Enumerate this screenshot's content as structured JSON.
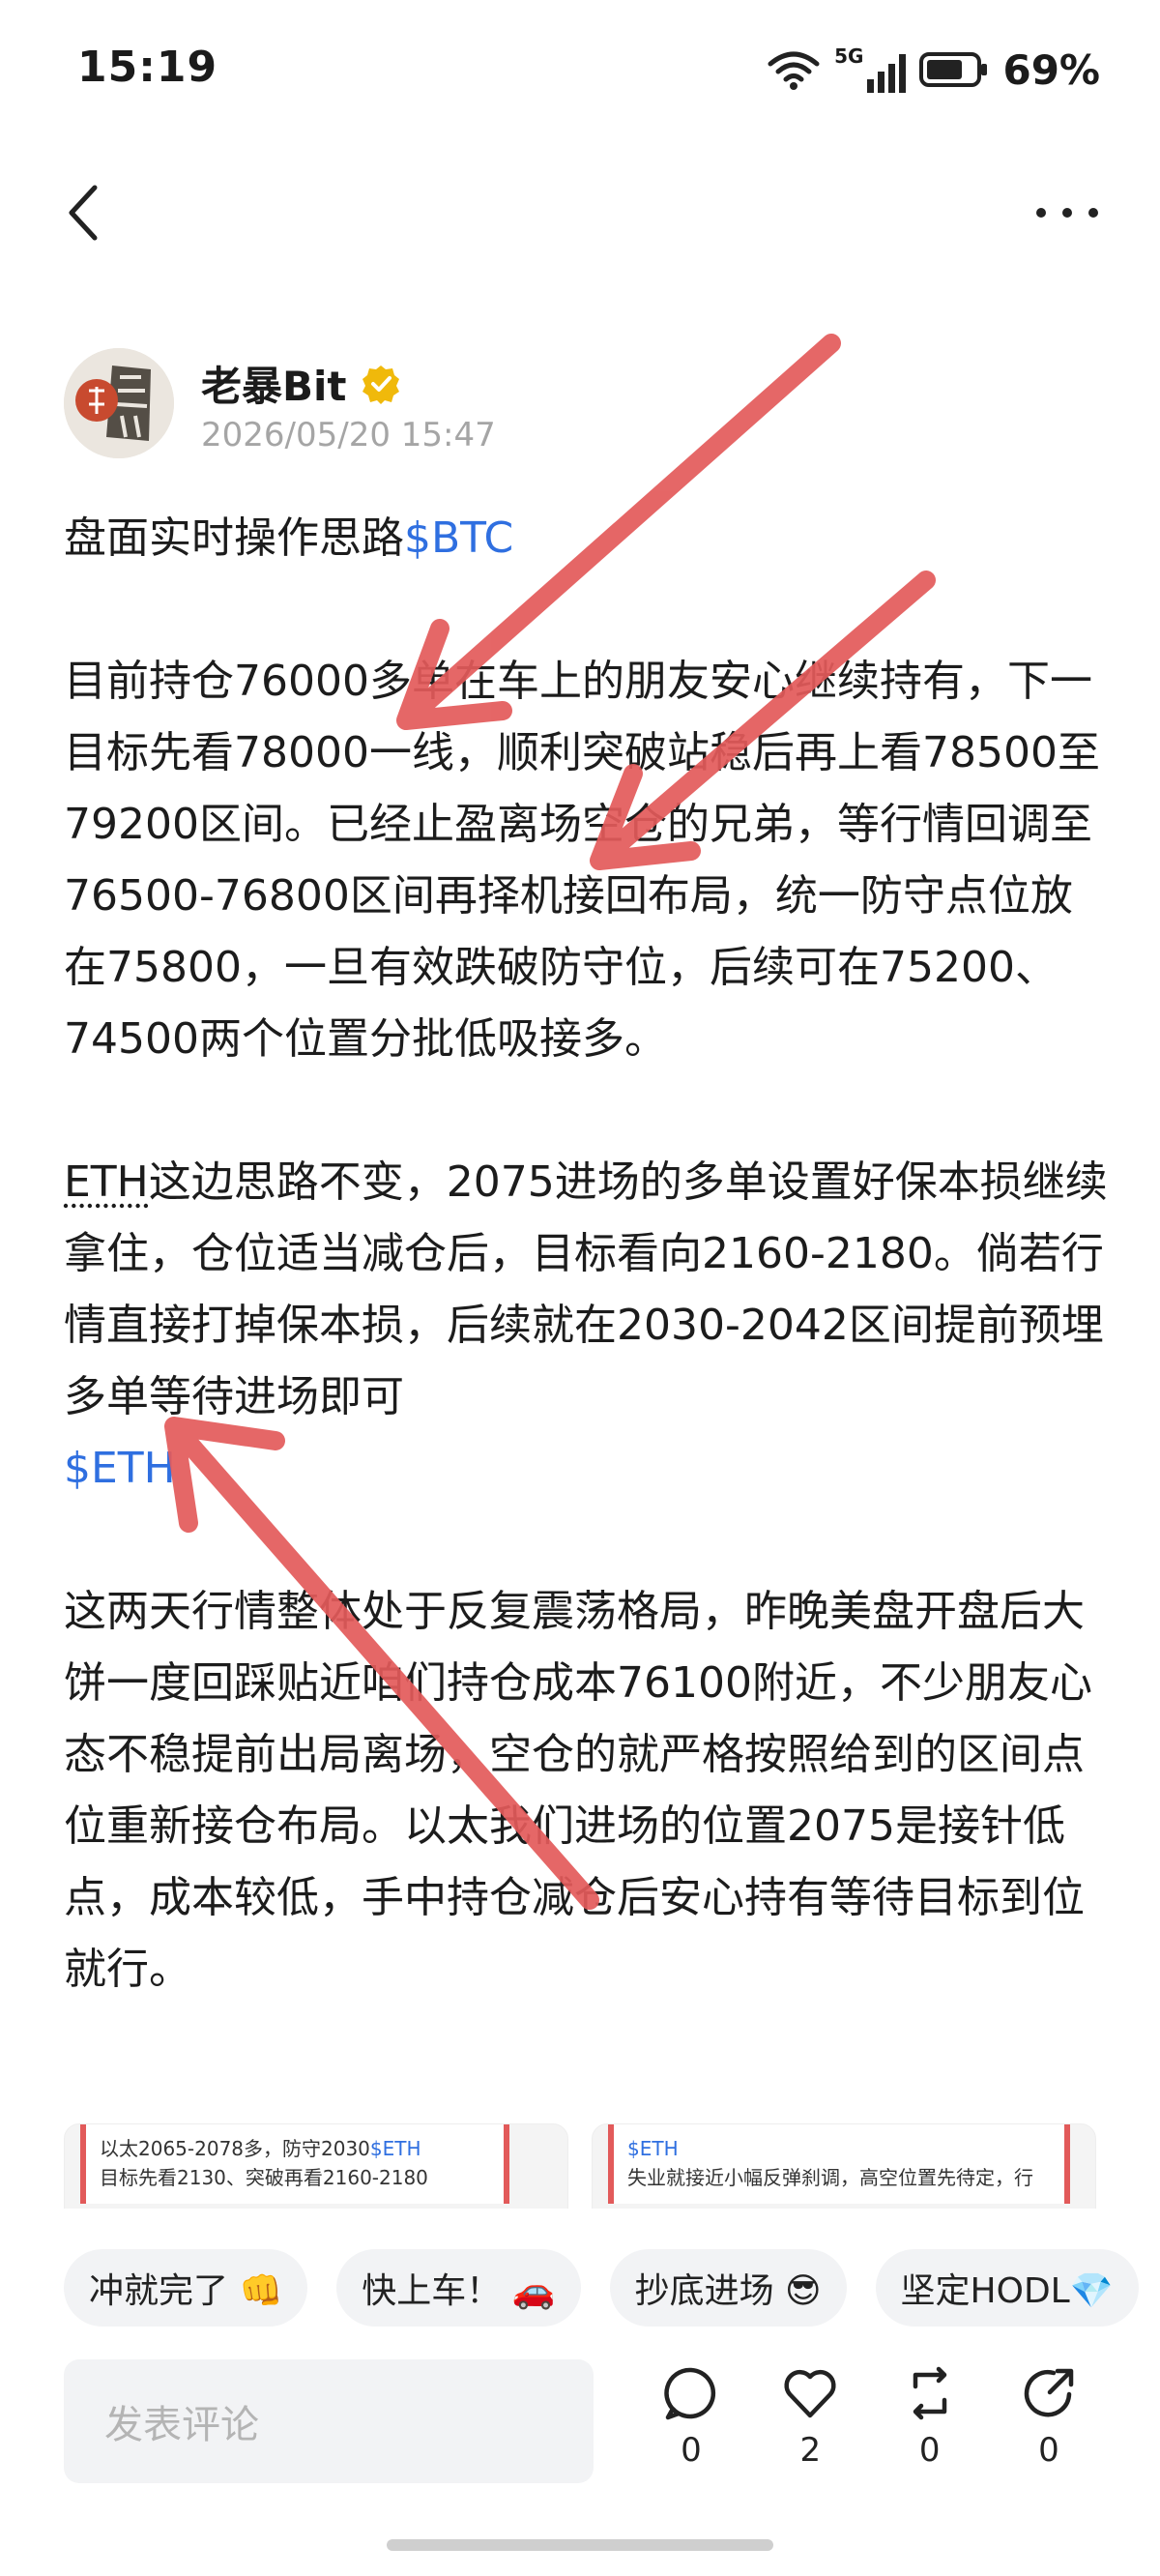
{
  "status_bar": {
    "time": "15:19",
    "network": "5G",
    "battery_percent": "69%"
  },
  "nav": {
    "back_icon": "chevron-left-icon",
    "more_icon": "more-dots-icon"
  },
  "author": {
    "name": "老暴Bit",
    "timestamp": "2026/05/20 15:47"
  },
  "post": {
    "line1_text": "盘面实时操作思路",
    "line1_tag": "$BTC",
    "para2": "目前持仓76000多单在车上的朋友安心继续持有，下一目标先看78000一线，顺利突破站稳后再上看78500至79200区间。已经止盈离场空仓的兄弟，等行情回调至76500-76800区间再择机接回布局，统一防守点位放在75800，一旦有效跌破防守位，后续可在75200、74500两个位置分批低吸接多。",
    "para3_eth": "ETH",
    "para3": "这边思路不变，2075进场的多单设置好保本损继续拿住，仓位适当减仓后，目标看向2160-2180。倘若行情直接打掉保本损，后续就在2030-2042区间提前预埋多单等待进场即可",
    "para3_tag": "$ETH",
    "para4": "这两天行情整体处于反复震荡格局，昨晚美盘开盘后大饼一度回踩贴近咱们持仓成本76100附近，不少朋友心态不稳提前出局离场，空仓的就严格按照给到的区间点位重新接仓布局。以太我们进场的位置2075是接针低点，成本较低，手中持仓减仓后安心持有等待目标到位就行。"
  },
  "images": {
    "thumb1_line1": "以太2065-2078多，防守2030",
    "thumb1_tag": "$ETH",
    "thumb1_line2": "目标先看2130、突破再看2160-2180",
    "thumb2_tag": "$ETH",
    "thumb2_line2": "失业就接近小幅反弹刹调，高空位置先待定，行"
  },
  "quick_replies": [
    "冲就完了 👊",
    "快上车！ 🚗",
    "抄底进场 😎",
    "坚定HODL💎"
  ],
  "comment": {
    "placeholder": "发表评论"
  },
  "actions": {
    "comment_count": "0",
    "like_count": "2",
    "repost_count": "0",
    "share_count": "0"
  },
  "colors": {
    "link": "#2f6fe0",
    "arrow": "#e35a5a",
    "verified": "#f0b90b"
  }
}
